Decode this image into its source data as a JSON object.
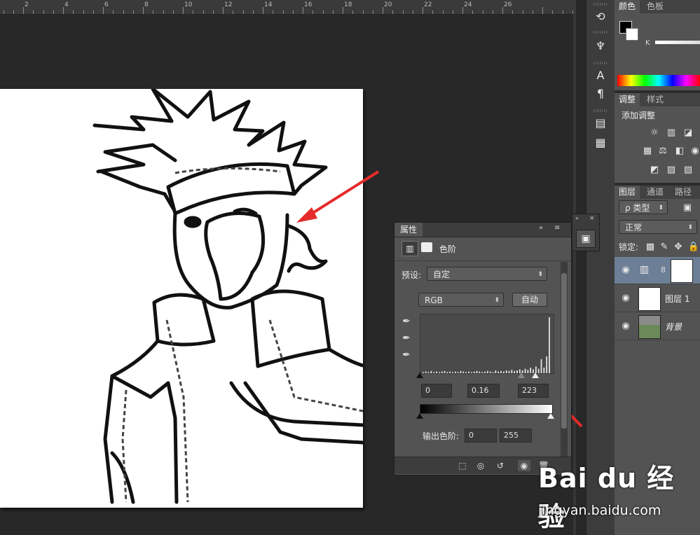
{
  "ruler": {
    "labels": [
      "2",
      "4",
      "6",
      "8",
      "10",
      "12",
      "14",
      "16",
      "18",
      "20",
      "22",
      "24",
      "26"
    ]
  },
  "color_panel": {
    "tabs": [
      "颜色",
      "色板"
    ],
    "channel_label": "K"
  },
  "adjust_panel": {
    "tabs": [
      "调整",
      "样式"
    ],
    "title": "添加调整"
  },
  "layers_panel": {
    "tabs": [
      "图层",
      "通道",
      "路径"
    ],
    "filter_label": "ρ 类型",
    "blend_mode": "正常",
    "lock_label": "锁定:",
    "layers": [
      {
        "name": ""
      },
      {
        "name": "图层 1"
      },
      {
        "name": "背景"
      }
    ]
  },
  "properties": {
    "tab": "属性",
    "section_title": "色阶",
    "preset_label": "预设:",
    "preset_value": "自定",
    "channel_value": "RGB",
    "auto_button": "自动",
    "input_black": "0",
    "input_gamma": "0.16",
    "input_white": "223",
    "output_label": "输出色阶:",
    "output_black": "0",
    "output_white": "255"
  },
  "watermark": {
    "brand": "Bai du 经验",
    "url": "jingyan.baidu.com"
  },
  "chart_data": {
    "type": "bar",
    "categories": [],
    "histogram": [
      0.02,
      0.03,
      0.02,
      0.04,
      0.02,
      0.03,
      0.02,
      0.03,
      0.04,
      0.02,
      0.03,
      0.02,
      0.03,
      0.02,
      0.04,
      0.03,
      0.02,
      0.03,
      0.02,
      0.03,
      0.04,
      0.03,
      0.02,
      0.03,
      0.04,
      0.03,
      0.02,
      0.05,
      0.03,
      0.04,
      0.03,
      0.05,
      0.04,
      0.06,
      0.04,
      0.05,
      0.07,
      0.05,
      0.08,
      0.06,
      0.1,
      0.07,
      0.12,
      0.08,
      0.25,
      0.1,
      0.3,
      1.0
    ]
  }
}
